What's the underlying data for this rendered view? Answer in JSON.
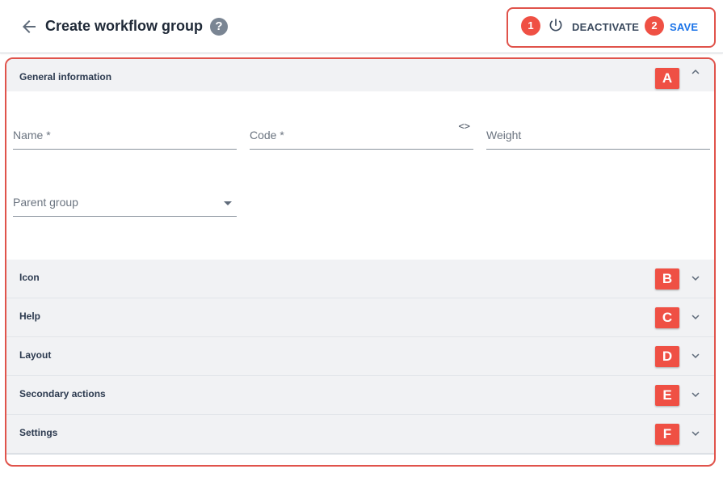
{
  "header": {
    "title": "Create workflow group",
    "back_icon": "arrow-left-icon",
    "help_icon": "help-circle-icon",
    "help_glyph": "?",
    "deactivate_badge": "1",
    "deactivate_label": "DEACTIVATE",
    "deactivate_icon": "power-icon",
    "save_badge": "2",
    "save_label": "SAVE"
  },
  "sections": {
    "general": {
      "title": "General information",
      "badge": "A",
      "expanded": true
    },
    "icon": {
      "title": "Icon",
      "badge": "B",
      "expanded": false
    },
    "help": {
      "title": "Help",
      "badge": "C",
      "expanded": false
    },
    "layout": {
      "title": "Layout",
      "badge": "D",
      "expanded": false
    },
    "secondary_actions": {
      "title": "Secondary actions",
      "badge": "E",
      "expanded": false
    },
    "settings": {
      "title": "Settings",
      "badge": "F",
      "expanded": false
    }
  },
  "form": {
    "name": {
      "label": "Name *",
      "value": ""
    },
    "code": {
      "label": "Code *",
      "value": "",
      "toggle_glyph": "<>"
    },
    "weight": {
      "label": "Weight",
      "value": ""
    },
    "parent_group": {
      "label": "Parent group",
      "value": ""
    }
  },
  "colors": {
    "accent": "#1a73e8",
    "annotation": "#ef5044",
    "section_bg": "#f1f2f4"
  }
}
